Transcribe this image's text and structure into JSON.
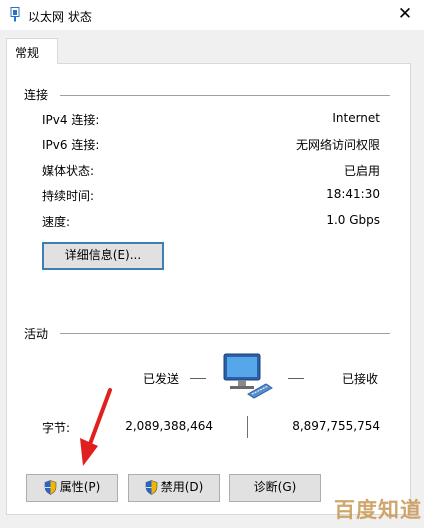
{
  "window": {
    "title": "以太网 状态",
    "close_glyph": "✕"
  },
  "tabs": [
    {
      "label": "常规"
    }
  ],
  "connection": {
    "section_label": "连接",
    "rows": [
      {
        "label": "IPv4 连接:",
        "value": "Internet"
      },
      {
        "label": "IPv6 连接:",
        "value": "无网络访问权限"
      },
      {
        "label": "媒体状态:",
        "value": "已启用"
      },
      {
        "label": "持续时间:",
        "value": "18:41:30"
      },
      {
        "label": "速度:",
        "value": "1.0 Gbps"
      }
    ],
    "details_button": "详细信息(E)..."
  },
  "activity": {
    "section_label": "活动",
    "sent_label": "已发送",
    "received_label": "已接收",
    "bytes_label": "字节:",
    "bytes_sent": "2,089,388,464",
    "bytes_received": "8,897,755,754",
    "icon": "network-computer-icon"
  },
  "buttons": {
    "properties": "属性(P)",
    "disable": "禁用(D)",
    "diagnose": "诊断(G)"
  },
  "overlay": {
    "watermark": "百度知道",
    "arrow_color": "#e02020"
  }
}
